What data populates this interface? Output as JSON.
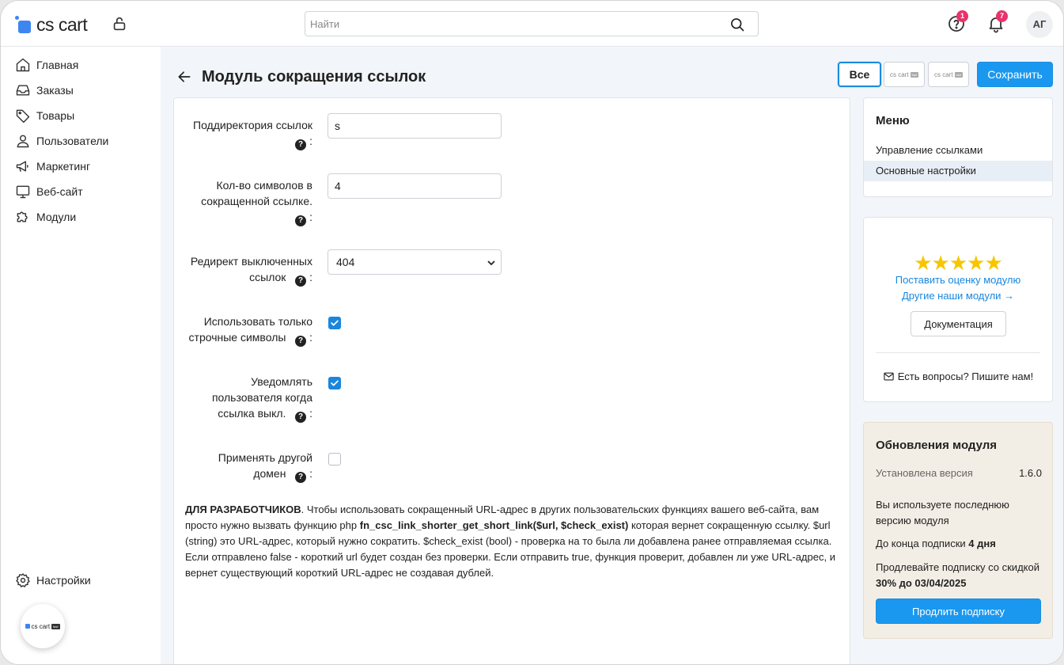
{
  "topbar": {
    "logo_text": "cs cart",
    "search_placeholder": "Найти",
    "help_badge": "1",
    "notifications_badge": "7",
    "avatar_initials": "АГ"
  },
  "sidebar": {
    "items": [
      {
        "label": "Главная",
        "icon": "home-icon"
      },
      {
        "label": "Заказы",
        "icon": "inbox-icon"
      },
      {
        "label": "Товары",
        "icon": "tag-icon"
      },
      {
        "label": "Пользователи",
        "icon": "user-icon"
      },
      {
        "label": "Маркетинг",
        "icon": "megaphone-icon"
      },
      {
        "label": "Веб-сайт",
        "icon": "monitor-icon"
      },
      {
        "label": "Модули",
        "icon": "puzzle-icon"
      }
    ],
    "settings_label": "Настройки",
    "bubble_logo_text": "cs cart",
    "bubble_logo_tag": "fasf"
  },
  "header": {
    "title": "Модуль сокращения ссылок",
    "btn_all": "Все",
    "storefront_logo_text": "cs cart",
    "storefront_logo_tag": "fasf",
    "btn_save": "Сохранить"
  },
  "form": {
    "subdir_label_1": "Поддиректория ссылок",
    "subdir_value": "s",
    "chars_label_1": "Кол-во символов в",
    "chars_label_2": "сокращенной ссылке.",
    "chars_value": "4",
    "redirect_label_1": "Редирект выключенных",
    "redirect_label_2": "ссылок",
    "redirect_value": "404",
    "lowercase_label_1": "Использовать только",
    "lowercase_label_2": "строчные символы",
    "lowercase_checked": true,
    "notify_label_1": "Уведомлять",
    "notify_label_2": "пользователя когда",
    "notify_label_3": "ссылка выкл.",
    "notify_checked": true,
    "domain_label_1": "Применять другой",
    "domain_label_2": "домен",
    "domain_checked": false,
    "help_glyph": "?",
    "colon": ":"
  },
  "dev_note": {
    "bold_lead": "ДЛЯ РАЗРАБОТЧИКОВ",
    "text_1": ". Чтобы использовать сокращенный URL-адрес в других пользовательских функциях вашего веб-сайта, вам просто нужно вызвать функцию php ",
    "function_name": "fn_csc_link_shorter_get_short_link($url, $check_exist)",
    "text_2": " которая вернет сокращенную ссылку. $url (string) это URL-адрес, который нужно сократить. $check_exist (bool) - проверка на то была ли добавлена ранее отправляемая ссылка. Если отправлено false - короткий url будет создан без проверки. Если отправить true, функция проверит, добавлен ли уже URL-адрес, и вернет существующий короткий URL-адрес не создавая дублей."
  },
  "menu_card": {
    "title": "Меню",
    "items": [
      "Управление ссылками",
      "Основные настройки"
    ],
    "active_index": 1
  },
  "rating_card": {
    "stars": "★★★★★",
    "rate_link": "Поставить оценку модулю",
    "other_modules_link": "Другие наши модули →",
    "docs_button": "Документация",
    "contact_text": "Есть вопросы? Пишите нам!"
  },
  "updates_card": {
    "title": "Обновления модуля",
    "installed_label": "Установлена версия",
    "installed_version": "1.6.0",
    "latest_text": "Вы используете последнюю версию модуля",
    "subscription_text": "До конца подписки ",
    "subscription_days": "4 дня",
    "renew_text": "Продлевайте подписку со скидкой ",
    "renew_discount": "30% до 03/04/2025",
    "renew_button": "Продлить подписку"
  },
  "colors": {
    "accent": "#1a98f0",
    "badge": "#e8336b",
    "star": "#f7c600",
    "main_bg": "#f2f5f9",
    "update_card_bg": "#f3eee5"
  }
}
